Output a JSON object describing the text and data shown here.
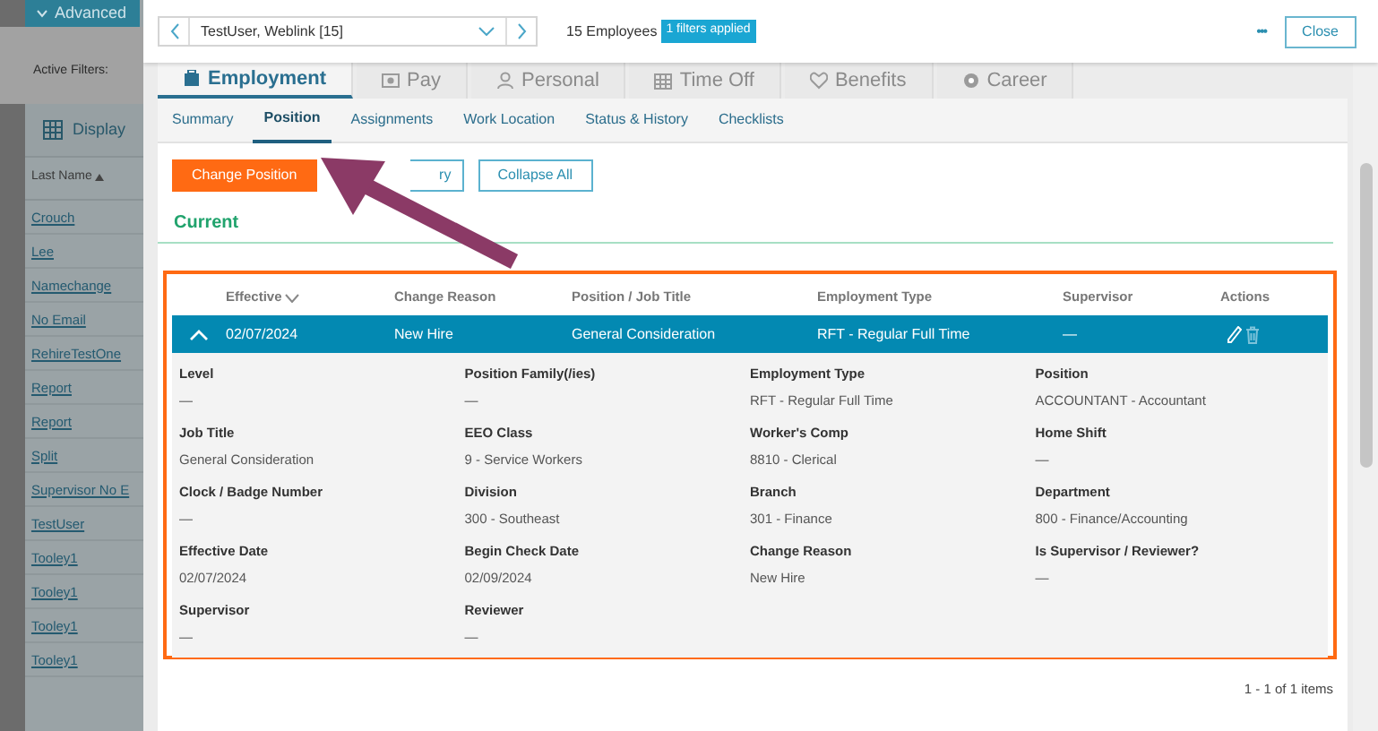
{
  "background_panel": {
    "advanced_button": "Advanced",
    "active_filters_label": "Active Filters:",
    "display_button": "Display",
    "sort_column": "Last Name",
    "names": [
      "Crouch",
      "Lee",
      "Namechange",
      "No Email",
      "RehireTestOne",
      "Report",
      "Report",
      "Split",
      "Supervisor No E",
      "TestUser",
      "Tooley1",
      "Tooley1",
      "Tooley1",
      "Tooley1"
    ]
  },
  "header": {
    "employee_select": "TestUser, Weblink [15]",
    "employee_count": "15 Employees",
    "filter_badge": "1 filters applied",
    "more": "•••",
    "close_button": "Close"
  },
  "tabs": [
    {
      "label": "Employment",
      "selected": true
    },
    {
      "label": "Pay",
      "selected": false
    },
    {
      "label": "Personal",
      "selected": false
    },
    {
      "label": "Time Off",
      "selected": false
    },
    {
      "label": "Benefits",
      "selected": false
    },
    {
      "label": "Career",
      "selected": false
    }
  ],
  "subtabs": [
    {
      "label": "Summary",
      "selected": false
    },
    {
      "label": "Position",
      "selected": true
    },
    {
      "label": "Assignments",
      "selected": false
    },
    {
      "label": "Work Location",
      "selected": false
    },
    {
      "label": "Status & History",
      "selected": false
    },
    {
      "label": "Checklists",
      "selected": false
    }
  ],
  "actions": [
    {
      "label": "Change Position",
      "kind": "primary"
    },
    {
      "label": "ry",
      "kind": "outline"
    },
    {
      "label": "Collapse All",
      "kind": "outline"
    }
  ],
  "section_title": "Current",
  "table": {
    "columns": [
      "Effective",
      "Change Reason",
      "Position / Job Title",
      "Employment Type",
      "Supervisor",
      "Actions"
    ],
    "rows": [
      {
        "expanded": true,
        "cells": [
          "02/07/2024",
          "New Hire",
          "General Consideration",
          "RFT - Regular Full Time",
          "—"
        ],
        "details": [
          {
            "label": "Level",
            "value": "—"
          },
          {
            "label": "Position Family(/ies)",
            "value": "—"
          },
          {
            "label": "Employment Type",
            "value": "RFT - Regular Full Time"
          },
          {
            "label": "Position",
            "value": "ACCOUNTANT - Accountant"
          },
          {
            "label": "Job Title",
            "value": "General Consideration"
          },
          {
            "label": "EEO Class",
            "value": "9 - Service Workers"
          },
          {
            "label": "Worker's Comp",
            "value": "8810 - Clerical"
          },
          {
            "label": "Home Shift",
            "value": "—"
          },
          {
            "label": "Clock / Badge Number",
            "value": "—"
          },
          {
            "label": "Division",
            "value": "300 - Southeast"
          },
          {
            "label": "Branch",
            "value": "301 - Finance"
          },
          {
            "label": "Department",
            "value": "800 - Finance/Accounting"
          },
          {
            "label": "Effective Date",
            "value": "02/07/2024"
          },
          {
            "label": "Begin Check Date",
            "value": "02/09/2024"
          },
          {
            "label": "Change Reason",
            "value": "New Hire"
          },
          {
            "label": "Is Supervisor / Reviewer?",
            "value": "—"
          },
          {
            "label": "Supervisor",
            "value": "—"
          },
          {
            "label": "Reviewer",
            "value": "—"
          }
        ]
      }
    ]
  },
  "pager": "1 - 1 of 1 items"
}
